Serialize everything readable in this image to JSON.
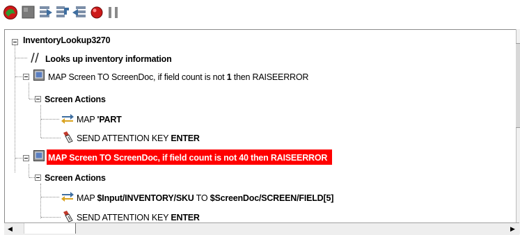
{
  "toolbar": {
    "buttons": [
      {
        "name": "run-icon",
        "color": "#d01818"
      },
      {
        "name": "stop-icon",
        "color": "#777777"
      },
      {
        "name": "step-over-icon",
        "color": "#4a6fa5"
      },
      {
        "name": "step-into-icon",
        "color": "#4a6fa5"
      },
      {
        "name": "step-out-icon",
        "color": "#4a6fa5"
      },
      {
        "name": "breakpoint-icon",
        "color": "#cc1a1a"
      },
      {
        "name": "pause-icon",
        "color": "#8a8a8a"
      }
    ]
  },
  "tree": {
    "root": "InventoryLookup3270",
    "comment": "Looks up inventory information",
    "map1": {
      "prefix": "MAP Screen TO ScreenDoc, if field count is not ",
      "count": "1",
      "suffix": " then RAISEERROR"
    },
    "actions1": "Screen Actions",
    "map_part": {
      "prefix": "MAP ",
      "value": "'PART"
    },
    "send1": {
      "prefix": "SEND ATTENTION KEY ",
      "key": "ENTER"
    },
    "map2": "MAP Screen TO ScreenDoc, if field count is not 40 then RAISEERROR",
    "actions2": "Screen Actions",
    "map_sku": {
      "prefix": "MAP ",
      "src": "$Input/INVENTORY/SKU",
      "mid": " TO ",
      "dst": "$ScreenDoc/SCREEN/FIELD[5]"
    },
    "send2": {
      "prefix": "SEND ATTENTION KEY ",
      "key": "ENTER"
    }
  },
  "colors": {
    "highlight": "#ff0000"
  }
}
